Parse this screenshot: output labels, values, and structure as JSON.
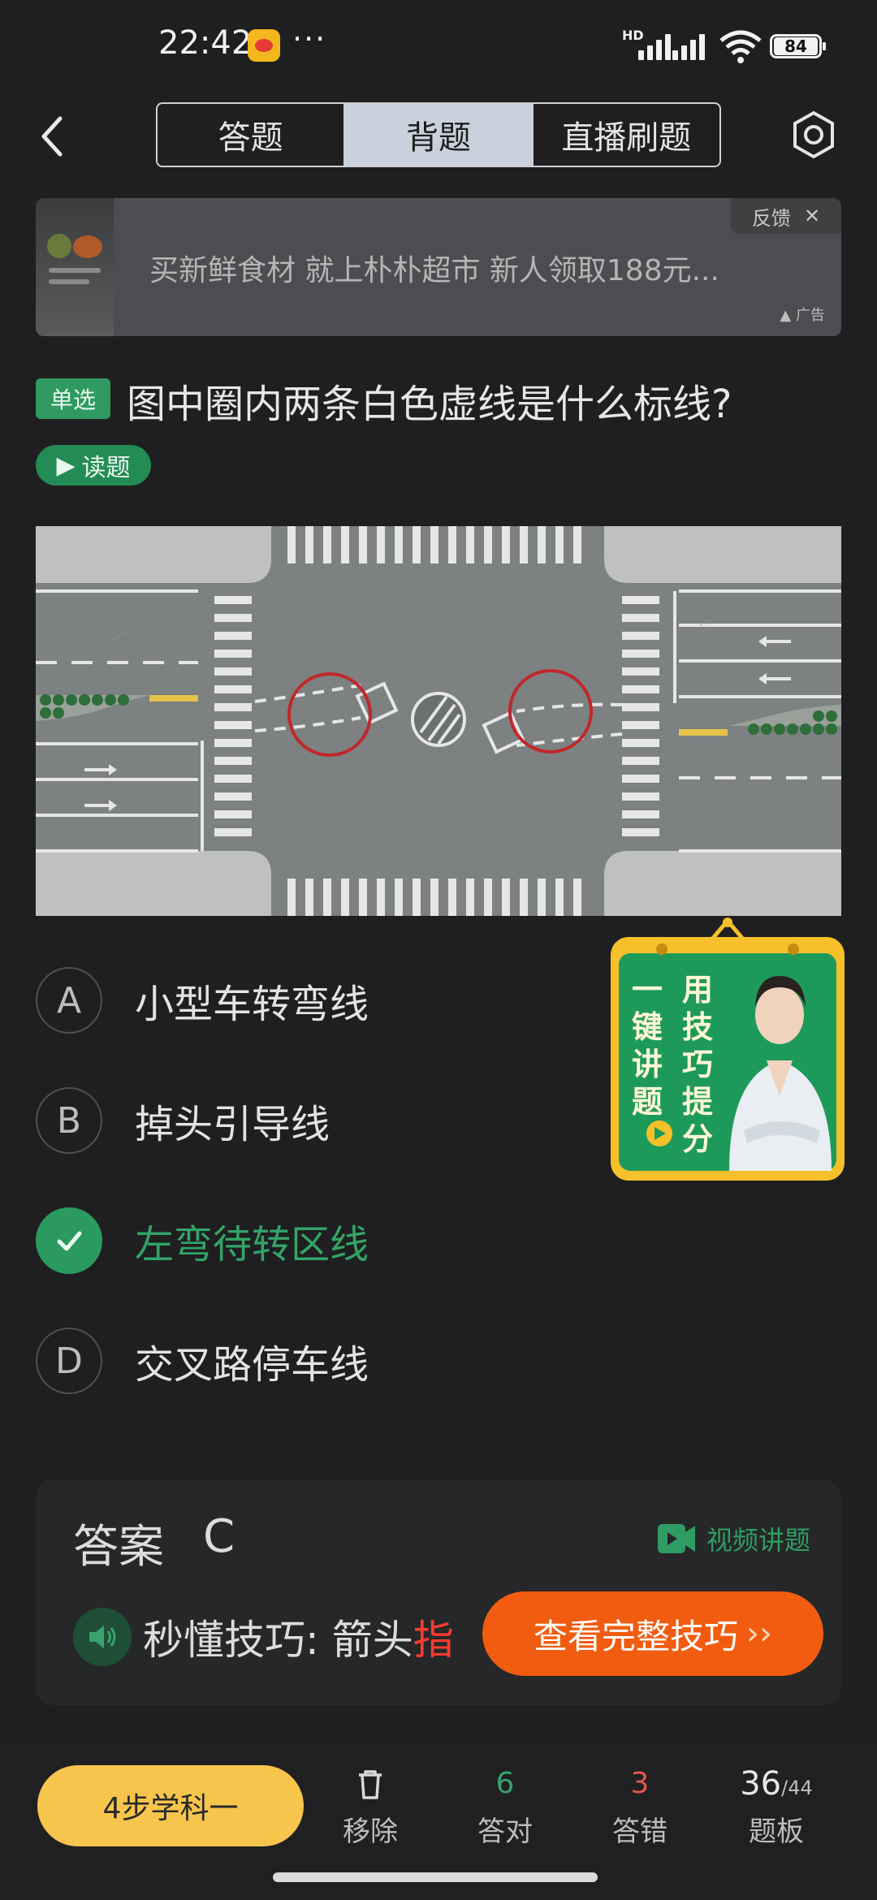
{
  "status_bar": {
    "time": "22:42",
    "network": "HD",
    "battery": "84"
  },
  "header": {
    "tabs": [
      {
        "label": "答题",
        "active": false
      },
      {
        "label": "背题",
        "active": true
      },
      {
        "label": "直播刷题",
        "active": false
      }
    ]
  },
  "ad": {
    "text": "买新鲜食材 就上朴朴超市 新人领取188元...",
    "feedback": "反馈",
    "tag": "广告"
  },
  "question": {
    "type_badge": "单选",
    "text": "图中圈内两条白色虚线是什么标线?",
    "read_button": "读题"
  },
  "options": [
    {
      "letter": "A",
      "label": "小型车转弯线",
      "correct": false
    },
    {
      "letter": "B",
      "label": "掉头引导线",
      "correct": false
    },
    {
      "letter": "C",
      "label": "左弯待转区线",
      "correct": true
    },
    {
      "letter": "D",
      "label": "交叉路停车线",
      "correct": false
    }
  ],
  "promo": {
    "line1": "一键讲题",
    "line2": "用技巧提分"
  },
  "answer": {
    "title": "答案",
    "value": "C",
    "video_link": "视频讲题",
    "tip_prefix": "秒懂技巧: 箭头",
    "tip_highlight": "指",
    "cta": "查看完整技巧"
  },
  "bottom": {
    "study_button": "4步学科一",
    "remove_label": "移除",
    "correct_count": "6",
    "correct_label": "答对",
    "wrong_count": "3",
    "wrong_label": "答错",
    "progress_current": "36",
    "progress_total": "/44",
    "board_label": "题板"
  },
  "colors": {
    "accent_green": "#2b9a5f",
    "cta_orange": "#f25c10",
    "study_yellow": "#f7c54b"
  }
}
